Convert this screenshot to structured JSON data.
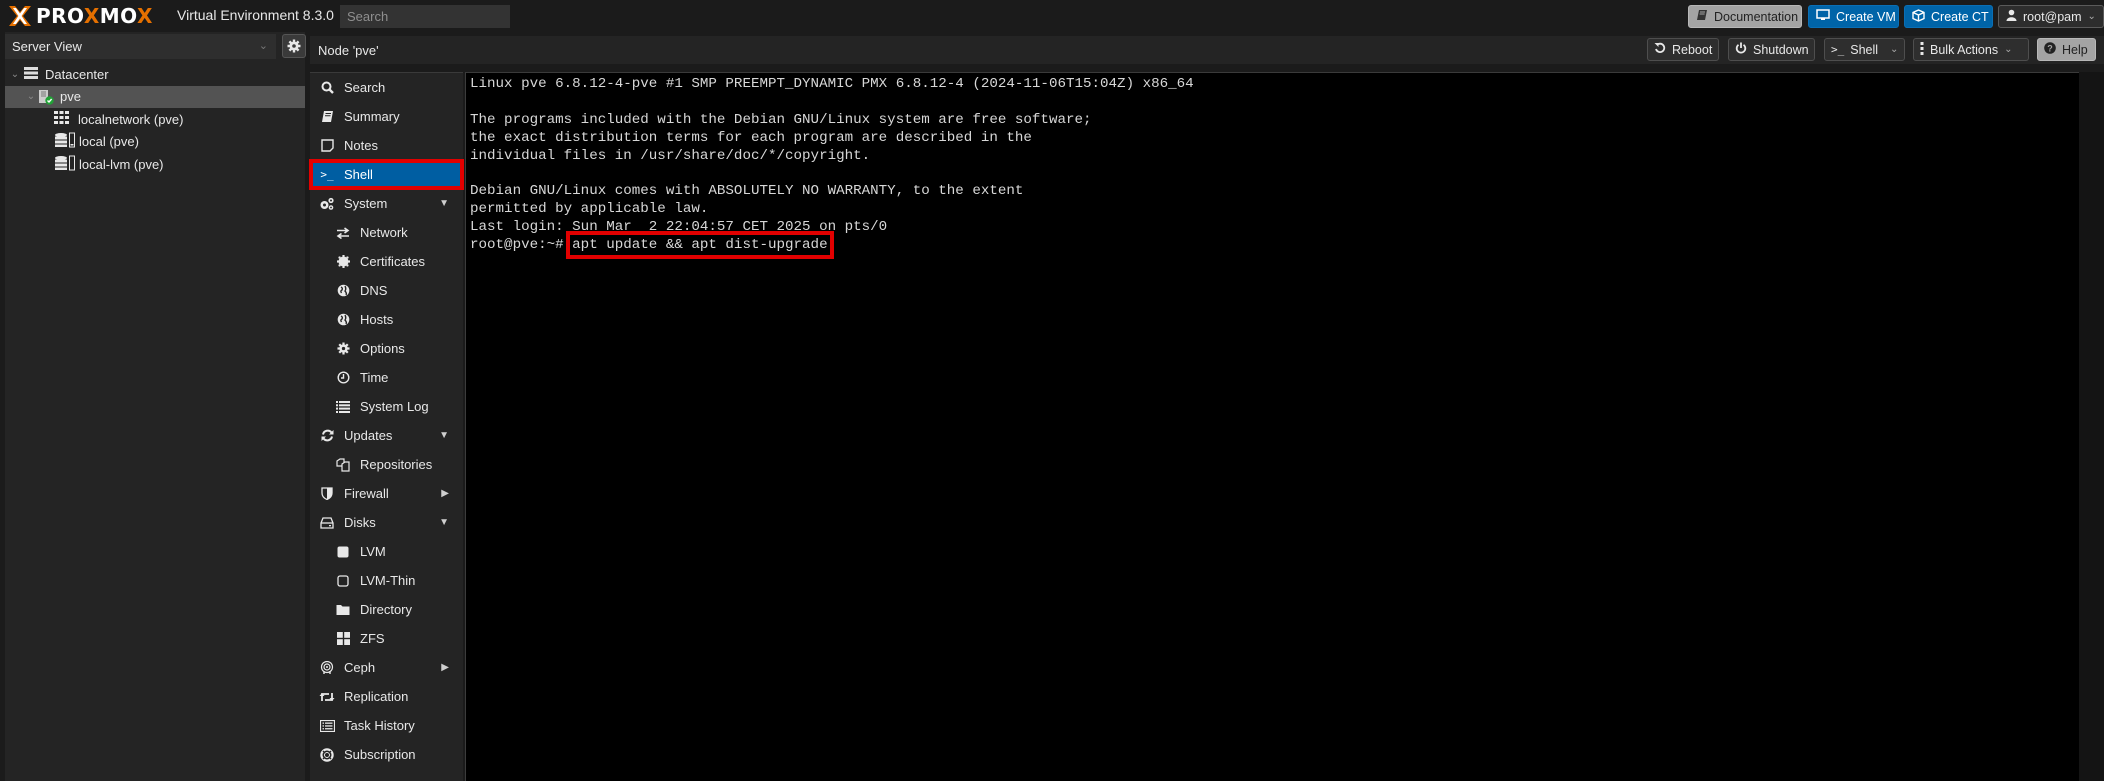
{
  "app": {
    "brand_prefix": "PRO",
    "brand_x1": "X",
    "brand_mid": "MO",
    "brand_x2": "X",
    "title": "Virtual Environment 8.3.0",
    "search_placeholder": "Search"
  },
  "topbar": {
    "documentation_label": "Documentation",
    "create_vm_label": "Create VM",
    "create_ct_label": "Create CT",
    "user_label": "root@pam"
  },
  "left": {
    "view_label": "Server View",
    "tree": [
      {
        "label": "Datacenter",
        "icon": "server-stack-icon"
      },
      {
        "label": "pve",
        "icon": "node-online-icon",
        "selected": true
      },
      {
        "label": "localnetwork (pve)",
        "icon": "network-grid-icon"
      },
      {
        "label": "local (pve)",
        "icon": "storage-icon"
      },
      {
        "label": "local-lvm (pve)",
        "icon": "storage-icon"
      }
    ]
  },
  "header": {
    "node_title": "Node 'pve'",
    "reboot_label": "Reboot",
    "shutdown_label": "Shutdown",
    "shell_label": "Shell",
    "bulk_label": "Bulk Actions",
    "help_label": "Help"
  },
  "nav": {
    "items": [
      {
        "label": "Search",
        "icon": "search-icon"
      },
      {
        "label": "Summary",
        "icon": "book-icon"
      },
      {
        "label": "Notes",
        "icon": "notes-icon"
      },
      {
        "label": "Shell",
        "icon": "terminal-icon",
        "active": true
      },
      {
        "label": "System",
        "icon": "cogs-icon",
        "arrow": "down"
      },
      {
        "label": "Network",
        "icon": "exchange-icon",
        "sub": true
      },
      {
        "label": "Certificates",
        "icon": "certificate-icon",
        "sub": true
      },
      {
        "label": "DNS",
        "icon": "globe-icon",
        "sub": true
      },
      {
        "label": "Hosts",
        "icon": "globe-icon",
        "sub": true
      },
      {
        "label": "Options",
        "icon": "gear-icon",
        "sub": true
      },
      {
        "label": "Time",
        "icon": "clock-icon",
        "sub": true
      },
      {
        "label": "System Log",
        "icon": "list-icon",
        "sub": true
      },
      {
        "label": "Updates",
        "icon": "refresh-icon",
        "arrow": "down"
      },
      {
        "label": "Repositories",
        "icon": "files-icon",
        "sub": true
      },
      {
        "label": "Firewall",
        "icon": "shield-icon",
        "arrow": "right"
      },
      {
        "label": "Disks",
        "icon": "hdd-icon",
        "arrow": "down"
      },
      {
        "label": "LVM",
        "icon": "square-filled-icon",
        "sub": true
      },
      {
        "label": "LVM-Thin",
        "icon": "square-outline-icon",
        "sub": true
      },
      {
        "label": "Directory",
        "icon": "folder-icon",
        "sub": true
      },
      {
        "label": "ZFS",
        "icon": "th-large-icon",
        "sub": true
      },
      {
        "label": "Ceph",
        "icon": "ceph-icon",
        "arrow": "right"
      },
      {
        "label": "Replication",
        "icon": "retweet-icon"
      },
      {
        "label": "Task History",
        "icon": "task-list-icon"
      },
      {
        "label": "Subscription",
        "icon": "support-icon"
      }
    ]
  },
  "terminal": {
    "lines": [
      "Linux pve 6.8.12-4-pve #1 SMP PREEMPT_DYNAMIC PMX 6.8.12-4 (2024-11-06T15:04Z) x86_64",
      "",
      "The programs included with the Debian GNU/Linux system are free software;",
      "the exact distribution terms for each program are described in the",
      "individual files in /usr/share/doc/*/copyright.",
      "",
      "Debian GNU/Linux comes with ABSOLUTELY NO WARRANTY, to the extent",
      "permitted by applicable law.",
      "Last login: Sun Mar  2 22:04:57 CET 2025 on pts/0"
    ],
    "prompt": "root@pve:~# ",
    "command": "apt update && apt dist-upgrade"
  },
  "colors": {
    "accent_blue": "#005ea2",
    "brand_orange": "#e57000",
    "highlight_red": "#e20000"
  }
}
